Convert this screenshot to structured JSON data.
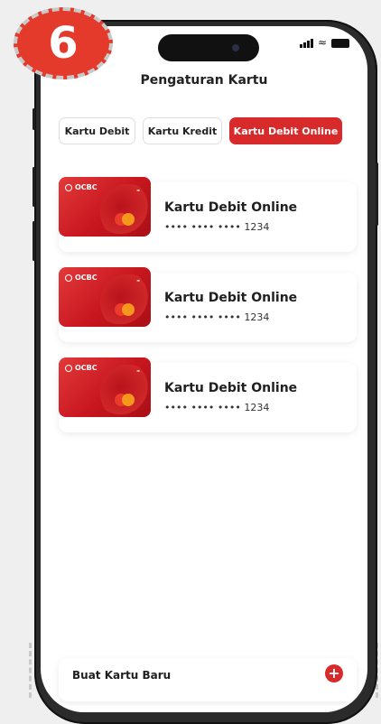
{
  "step_badge": "6",
  "header": {
    "title": "Pengaturan Kartu"
  },
  "tabs": [
    {
      "label": "Kartu Debit",
      "active": false
    },
    {
      "label": "Kartu Kredit",
      "active": false
    },
    {
      "label": "Kartu Debit Online",
      "active": true
    }
  ],
  "cards": [
    {
      "brand": "OCBC",
      "name": "Kartu Debit Online",
      "number": "•••• •••• •••• 1234"
    },
    {
      "brand": "OCBC",
      "name": "Kartu Debit Online",
      "number": "•••• •••• •••• 1234"
    },
    {
      "brand": "OCBC",
      "name": "Kartu Debit Online",
      "number": "•••• •••• •••• 1234"
    }
  ],
  "footer": {
    "create_label": "Buat Kartu Baru"
  },
  "colors": {
    "accent": "#d82a2a",
    "badge": "#e43a2c"
  },
  "icons": {
    "plus": "plus-circle-icon",
    "signal": "signal-icon",
    "wifi": "wifi-icon",
    "battery": "battery-icon"
  }
}
